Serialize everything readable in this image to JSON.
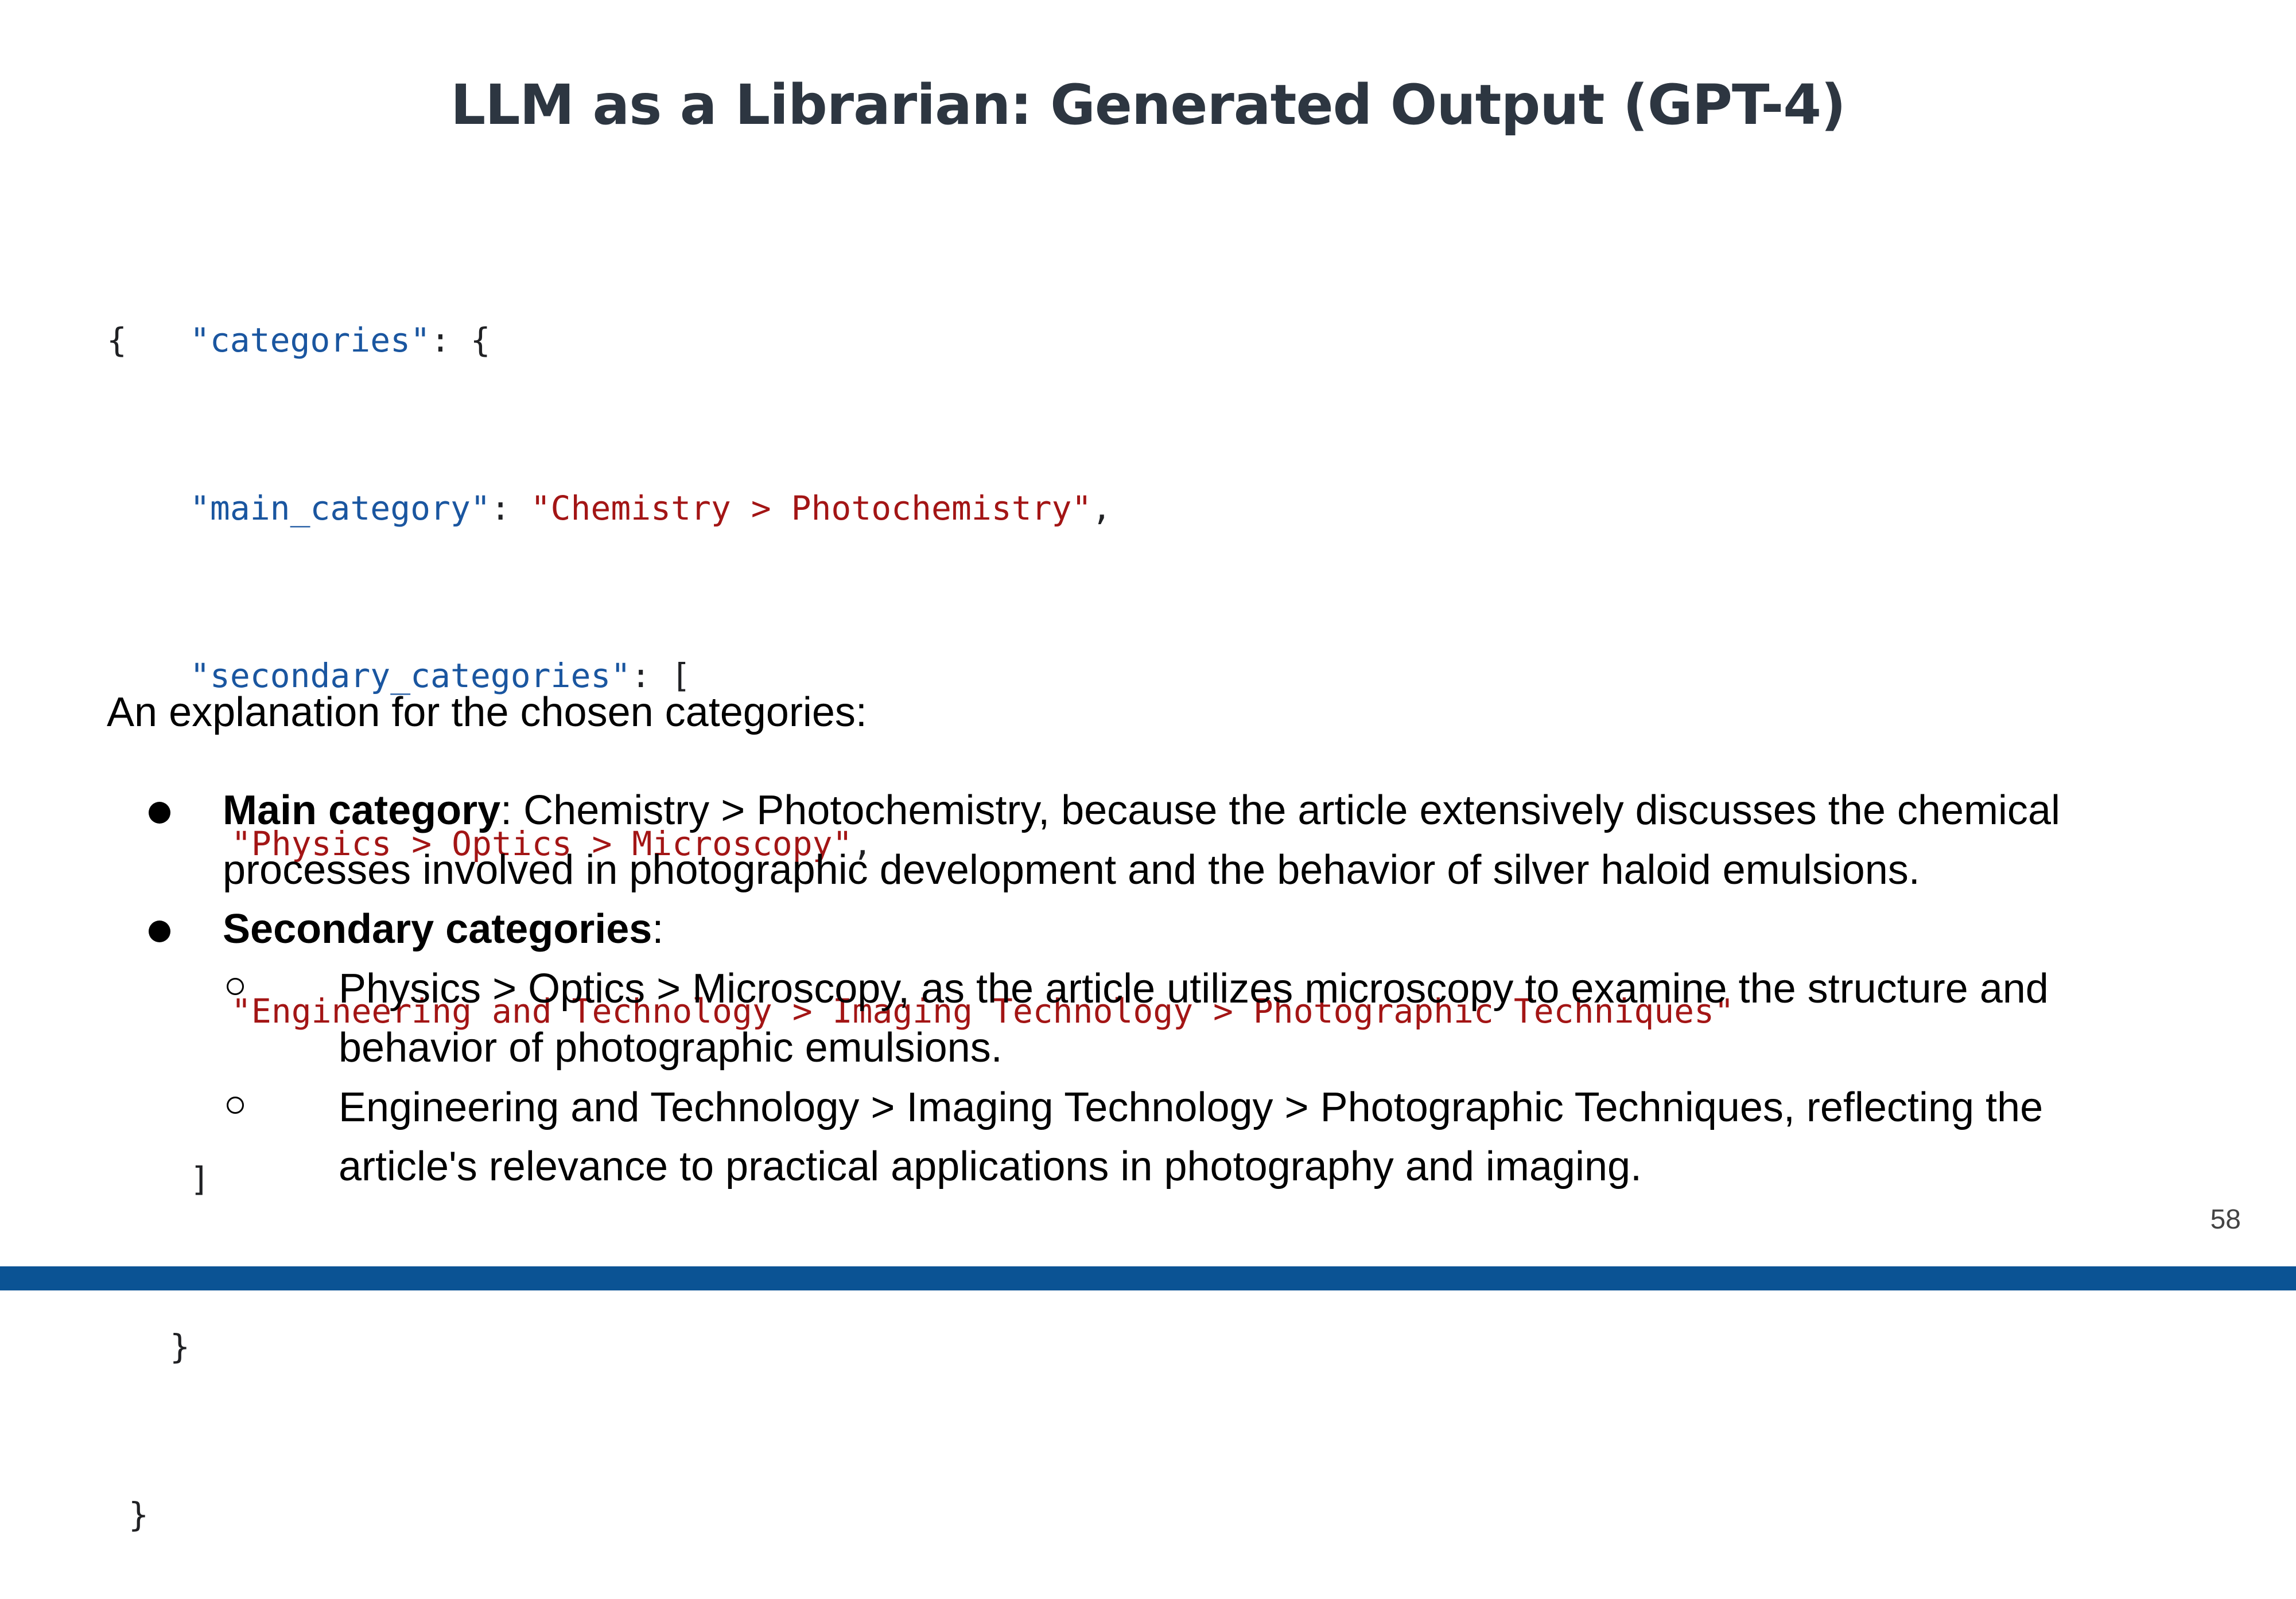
{
  "slide": {
    "title": "LLM as a Librarian: Generated Output (GPT-4)",
    "page_number": "58"
  },
  "code": {
    "open_brace": "{",
    "categories_key": "\"categories\"",
    "colon_open": ": {",
    "main_category_key": "\"main_category\"",
    "colon": ": ",
    "main_category_value": "\"Chemistry > Photochemistry\"",
    "comma": ",",
    "secondary_key": "\"secondary_categories\"",
    "colon_bracket": ": [",
    "secondary_values": [
      "\"Physics > Optics > Microscopy\"",
      "\"Engineering and Technology > Imaging Technology > Photographic Techniques\""
    ],
    "close_bracket": "]",
    "close_inner_brace": "}",
    "close_outer_brace": "}"
  },
  "explanation": {
    "intro": "An explanation for the chosen categories:",
    "main": {
      "label": "Main category",
      "text": ": Chemistry > Photochemistry, because the article extensively discusses the chemical processes involved in photographic development and the behavior of silver haloid emulsions."
    },
    "secondary": {
      "label": "Secondary categories",
      "text": ":",
      "items": [
        "Physics > Optics > Microscopy, as the article utilizes microscopy to examine the structure and behavior of photographic emulsions.",
        "Engineering and Technology > Imaging Technology > Photographic Techniques, reflecting the article's relevance to practical applications in photography and imaging."
      ]
    }
  },
  "colors": {
    "title": "#2d3641",
    "json_key": "#1a56a0",
    "json_string": "#a31515",
    "footer_bar": "#0b5394"
  }
}
